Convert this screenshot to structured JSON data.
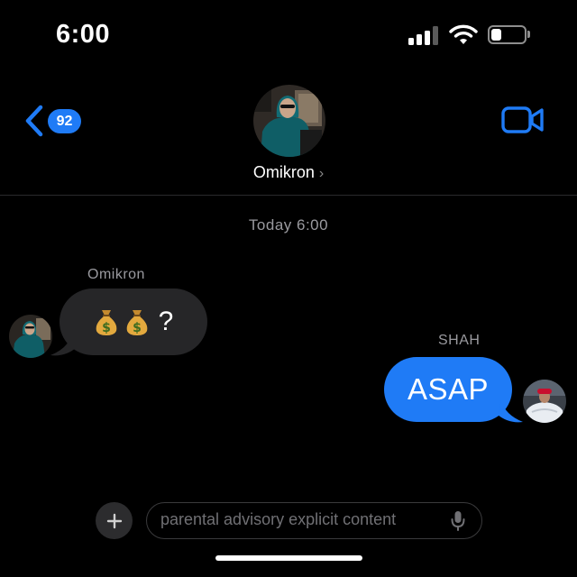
{
  "status_bar": {
    "time": "6:00",
    "signal_bars_active": 3,
    "signal_bars_total": 4,
    "battery_level": 0.3
  },
  "header": {
    "unread_count": "92",
    "contact_name": "Omikron",
    "chevron": "›"
  },
  "conversation": {
    "timestamp": "Today 6:00",
    "messages": [
      {
        "sender": "Omikron",
        "direction": "incoming",
        "text": "💰💰?"
      },
      {
        "sender": "SHAH",
        "direction": "outgoing",
        "text": "ASAP"
      }
    ]
  },
  "composer": {
    "placeholder": "parental advisory explicit content",
    "plus_label": "+"
  },
  "icons": {
    "back": "chevron-left-icon",
    "video": "video-camera-icon",
    "plus": "plus-icon",
    "mic": "microphone-icon",
    "moneybag": "money-bag-icon"
  },
  "colors": {
    "accent": "#1f7bf6",
    "incoming_bubble": "#262628",
    "background": "#000000",
    "muted_text": "#9a9a9f"
  }
}
